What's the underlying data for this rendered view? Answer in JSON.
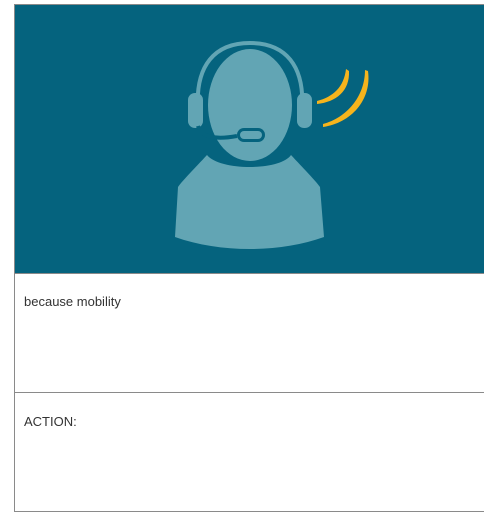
{
  "hero": {
    "background_color": "#05637e",
    "icon": "customer-support-headset-icon",
    "icon_color": "#62a5b4",
    "sound_waves_color": "#f6b41c"
  },
  "section_1": {
    "text": "because mobility"
  },
  "section_2": {
    "label": "ACTION:"
  }
}
